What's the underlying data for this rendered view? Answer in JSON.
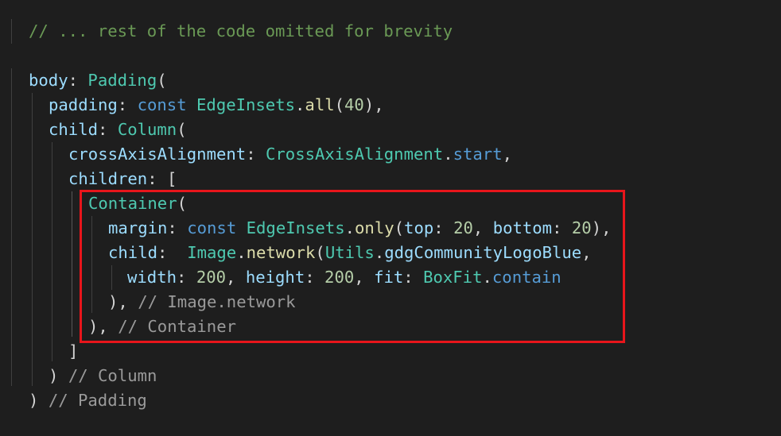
{
  "code": {
    "line1_comment": "// ... rest of the code omitted for brevity",
    "line3": {
      "body": "body",
      "colon": ": ",
      "padding": "Padding",
      "open": "("
    },
    "line4": {
      "padding": "padding",
      "colon": ": ",
      "const": "const",
      "space": " ",
      "edge": "EdgeInsets",
      "dot": ".",
      "all": "all",
      "open": "(",
      "num": "40",
      "close": "),"
    },
    "line5": {
      "child": "child",
      "colon": ": ",
      "column": "Column",
      "open": "("
    },
    "line6": {
      "cross": "crossAxisAlignment",
      "colon": ": ",
      "type": "CrossAxisAlignment",
      "dot": ".",
      "start": "start",
      "comma": ","
    },
    "line7": {
      "children": "children",
      "colon": ": ",
      "bracket": "["
    },
    "line8": {
      "container": "Container",
      "open": "("
    },
    "line9": {
      "margin": "margin",
      "colon": ": ",
      "const": "const",
      "space": " ",
      "edge": "EdgeInsets",
      "dot": ".",
      "only": "only",
      "open": "(",
      "top": "top",
      "colon2": ": ",
      "n20a": "20",
      "comma": ", ",
      "bottom": "bottom",
      "colon3": ": ",
      "n20b": "20",
      "close": "),"
    },
    "line10": {
      "child": "child",
      "colon": ":  ",
      "image": "Image",
      "dot": ".",
      "network": "network",
      "open": "(",
      "utils": "Utils",
      "dot2": ".",
      "logo": "gdgCommunityLogoBlue",
      "comma": ","
    },
    "line11": {
      "width": "width",
      "colon": ": ",
      "n200a": "200",
      "comma": ", ",
      "height": "height",
      "colon2": ": ",
      "n200b": "200",
      "comma2": ", ",
      "fit": "fit",
      "colon3": ": ",
      "boxfit": "BoxFit",
      "dot": ".",
      "contain": "contain"
    },
    "line12": {
      "close": "), ",
      "comment": "// Image.network"
    },
    "line13": {
      "close": "), ",
      "comment": "// Container"
    },
    "line14": {
      "bracket": "]"
    },
    "line15": {
      "close": ") ",
      "comment": "// Column"
    },
    "line16": {
      "close": ") ",
      "comment": "// Padding"
    }
  },
  "colors": {
    "background": "#1e1e1e",
    "highlight_border": "#e8151b",
    "comment": "#6a9955",
    "inline_comment": "#9a9a9a",
    "property": "#9cdcfe",
    "type": "#4ec9b0",
    "keyword": "#569cd6",
    "function": "#dcdcaa",
    "number": "#b5cea8"
  }
}
